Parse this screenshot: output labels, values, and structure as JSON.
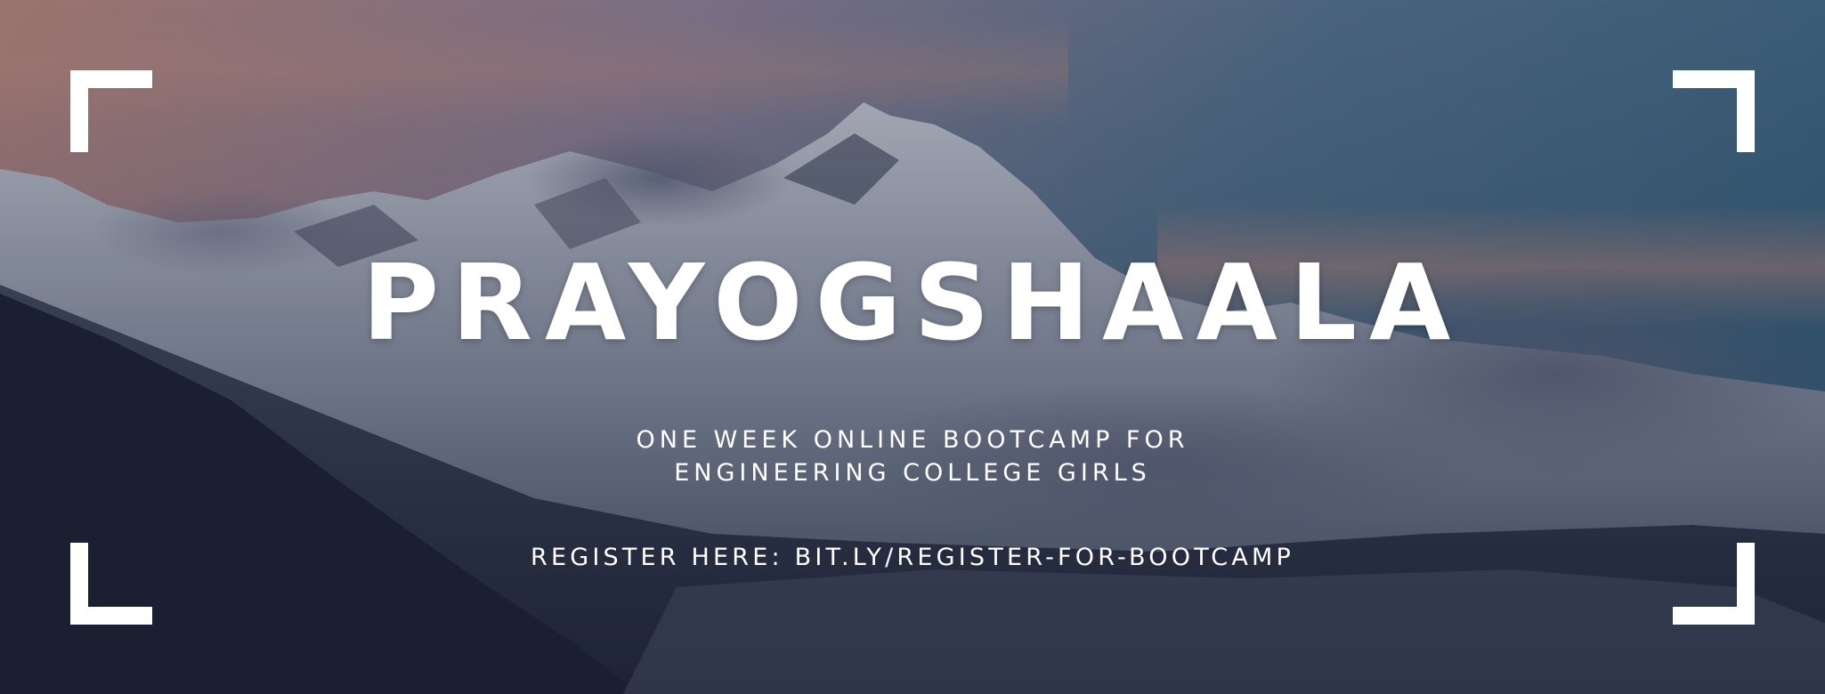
{
  "banner": {
    "title": "PRAYOGSHAALA",
    "subtitle_line1": "ONE WEEK ONLINE BOOTCAMP FOR",
    "subtitle_line2": "ENGINEERING COLLEGE GIRLS",
    "register_text": "REGISTER HERE: BIT.LY/REGISTER-FOR-BOOTCAMP"
  },
  "colors": {
    "text": "#ffffff",
    "sky_top": "#3d6f8f",
    "sky_warm": "#d79a8a",
    "mountain_dark": "#1f2538"
  },
  "icons": {
    "corners": [
      "corner-bracket-top-left-icon",
      "corner-bracket-top-right-icon",
      "corner-bracket-bottom-left-icon",
      "corner-bracket-bottom-right-icon"
    ]
  }
}
